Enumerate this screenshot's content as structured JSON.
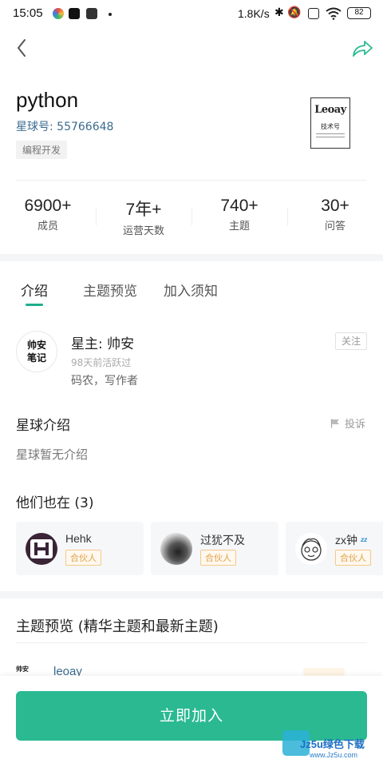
{
  "status_bar": {
    "time": "15:05",
    "net_speed": "1.8K/s",
    "battery": "82",
    "icons": [
      "app-colorful-icon",
      "tiktok-icon",
      "app-icon",
      "bluetooth-icon",
      "mute-icon",
      "sim-off-icon",
      "wifi-icon"
    ]
  },
  "nav": {
    "back_icon": "chevron-left-icon",
    "share_icon": "share-arrow-icon"
  },
  "group": {
    "title": "python",
    "planet_no": "星球号: 55766648",
    "tag": "编程开发",
    "logo_brand": "Leoay",
    "logo_sub": "技术号"
  },
  "stats": [
    {
      "value": "6900+",
      "label": "成员"
    },
    {
      "value": "7年+",
      "label": "运营天数"
    },
    {
      "value": "740+",
      "label": "主题"
    },
    {
      "value": "30+",
      "label": "问答"
    }
  ],
  "tabs": [
    {
      "label": "介绍",
      "active": true
    },
    {
      "label": "主题预览",
      "active": false
    },
    {
      "label": "加入须知",
      "active": false
    }
  ],
  "owner": {
    "avatar_text_line1": "帅安",
    "avatar_text_line2": "笔记",
    "name": "星主: 帅安",
    "active": "98天前活跃过",
    "desc": "码农，写作者",
    "follow": "关注"
  },
  "intro": {
    "title": "星球介绍",
    "report": "投诉",
    "text": "星球暂无介绍"
  },
  "members": {
    "title": "他们也在 (3)",
    "items": [
      {
        "name": "Hehk",
        "badge": "合伙人"
      },
      {
        "name": "过犹不及",
        "badge": "合伙人"
      },
      {
        "name": "zx钟",
        "badge": "合伙人"
      }
    ]
  },
  "preview": {
    "title": "主题预览 (精华主题和最新主题)",
    "peek_name": "leoay"
  },
  "join_button": "立即加入",
  "watermark": {
    "text": "Jz5u绿色下载",
    "url": "www.Jz5u.com"
  },
  "colors": {
    "accent": "#2bb992",
    "link_blue": "#3a6a8e",
    "badge_orange": "#e0a24a"
  }
}
